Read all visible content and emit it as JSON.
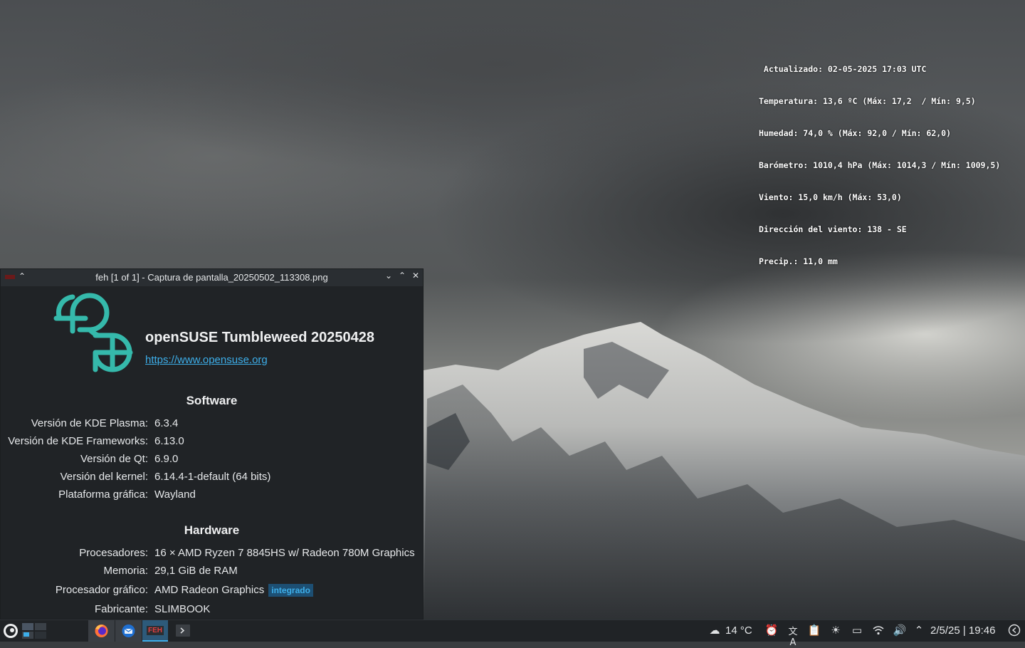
{
  "weather": {
    "lines": [
      " Actualizado: 02-05-2025 17:03 UTC",
      "Temperatura: 13,6 ºC (Máx: 17,2  / Mín: 9,5)",
      "Humedad: 74,0 % (Máx: 92,0 / Mín: 62,0)",
      "Barómetro: 1010,4 hPa (Máx: 1014,3 / Mín: 1009,5)",
      "Viento: 15,0 km/h (Máx: 53,0)",
      "Dirección del viento: 138 - SE",
      "Precip.: 11,0 mm"
    ]
  },
  "window": {
    "title": "feh [1 of 1] - Captura de pantalla_20250502_113308.png",
    "app_icon_label": "FEH"
  },
  "about": {
    "distro_name": "openSUSE Tumbleweed 20250428",
    "distro_url": "https://www.opensuse.org",
    "software_title": "Software",
    "software": [
      {
        "label": "Versión de KDE Plasma:",
        "value": "6.3.4"
      },
      {
        "label": "Versión de KDE Frameworks:",
        "value": "6.13.0"
      },
      {
        "label": "Versión de Qt:",
        "value": "6.9.0"
      },
      {
        "label": "Versión del kernel:",
        "value": "6.14.4-1-default (64 bits)"
      },
      {
        "label": "Plataforma gráfica:",
        "value": "Wayland"
      }
    ],
    "hardware_title": "Hardware",
    "hardware": [
      {
        "label": "Procesadores:",
        "value": "16 × AMD Ryzen 7 8845HS w/ Radeon 780M Graphics"
      },
      {
        "label": "Memoria:",
        "value": "29,1 GiB de RAM"
      },
      {
        "label": "Procesador gráfico:",
        "value": "AMD Radeon Graphics"
      },
      {
        "label": "Fabricante:",
        "value": "SLIMBOOK"
      }
    ],
    "gpu_badge": "integrado"
  },
  "taskbar": {
    "feh_label": "FEH",
    "weather_temp": "14 °C",
    "datetime": "2/5/25 | 19:46"
  },
  "colors": {
    "accent": "#3daee9",
    "opensuse_green": "#35b9ab",
    "panel_bg": "#202326"
  },
  "icons": {
    "launcher": "opensuse-launcher-icon",
    "pager": "virtual-desktop-pager-icon",
    "firefox": "firefox-icon",
    "thunderbird": "thunderbird-icon",
    "terminal": "terminal-icon",
    "weather": "cloud-rain-icon",
    "alarm": "alarm-clock-icon",
    "translate": "translate-icon",
    "clipboard": "clipboard-icon",
    "brightness": "brightness-icon",
    "display": "display-icon",
    "wifi": "wifi-icon",
    "volume": "volume-icon",
    "tray_expand": "chevron-up-icon",
    "notifications": "notifications-icon"
  }
}
